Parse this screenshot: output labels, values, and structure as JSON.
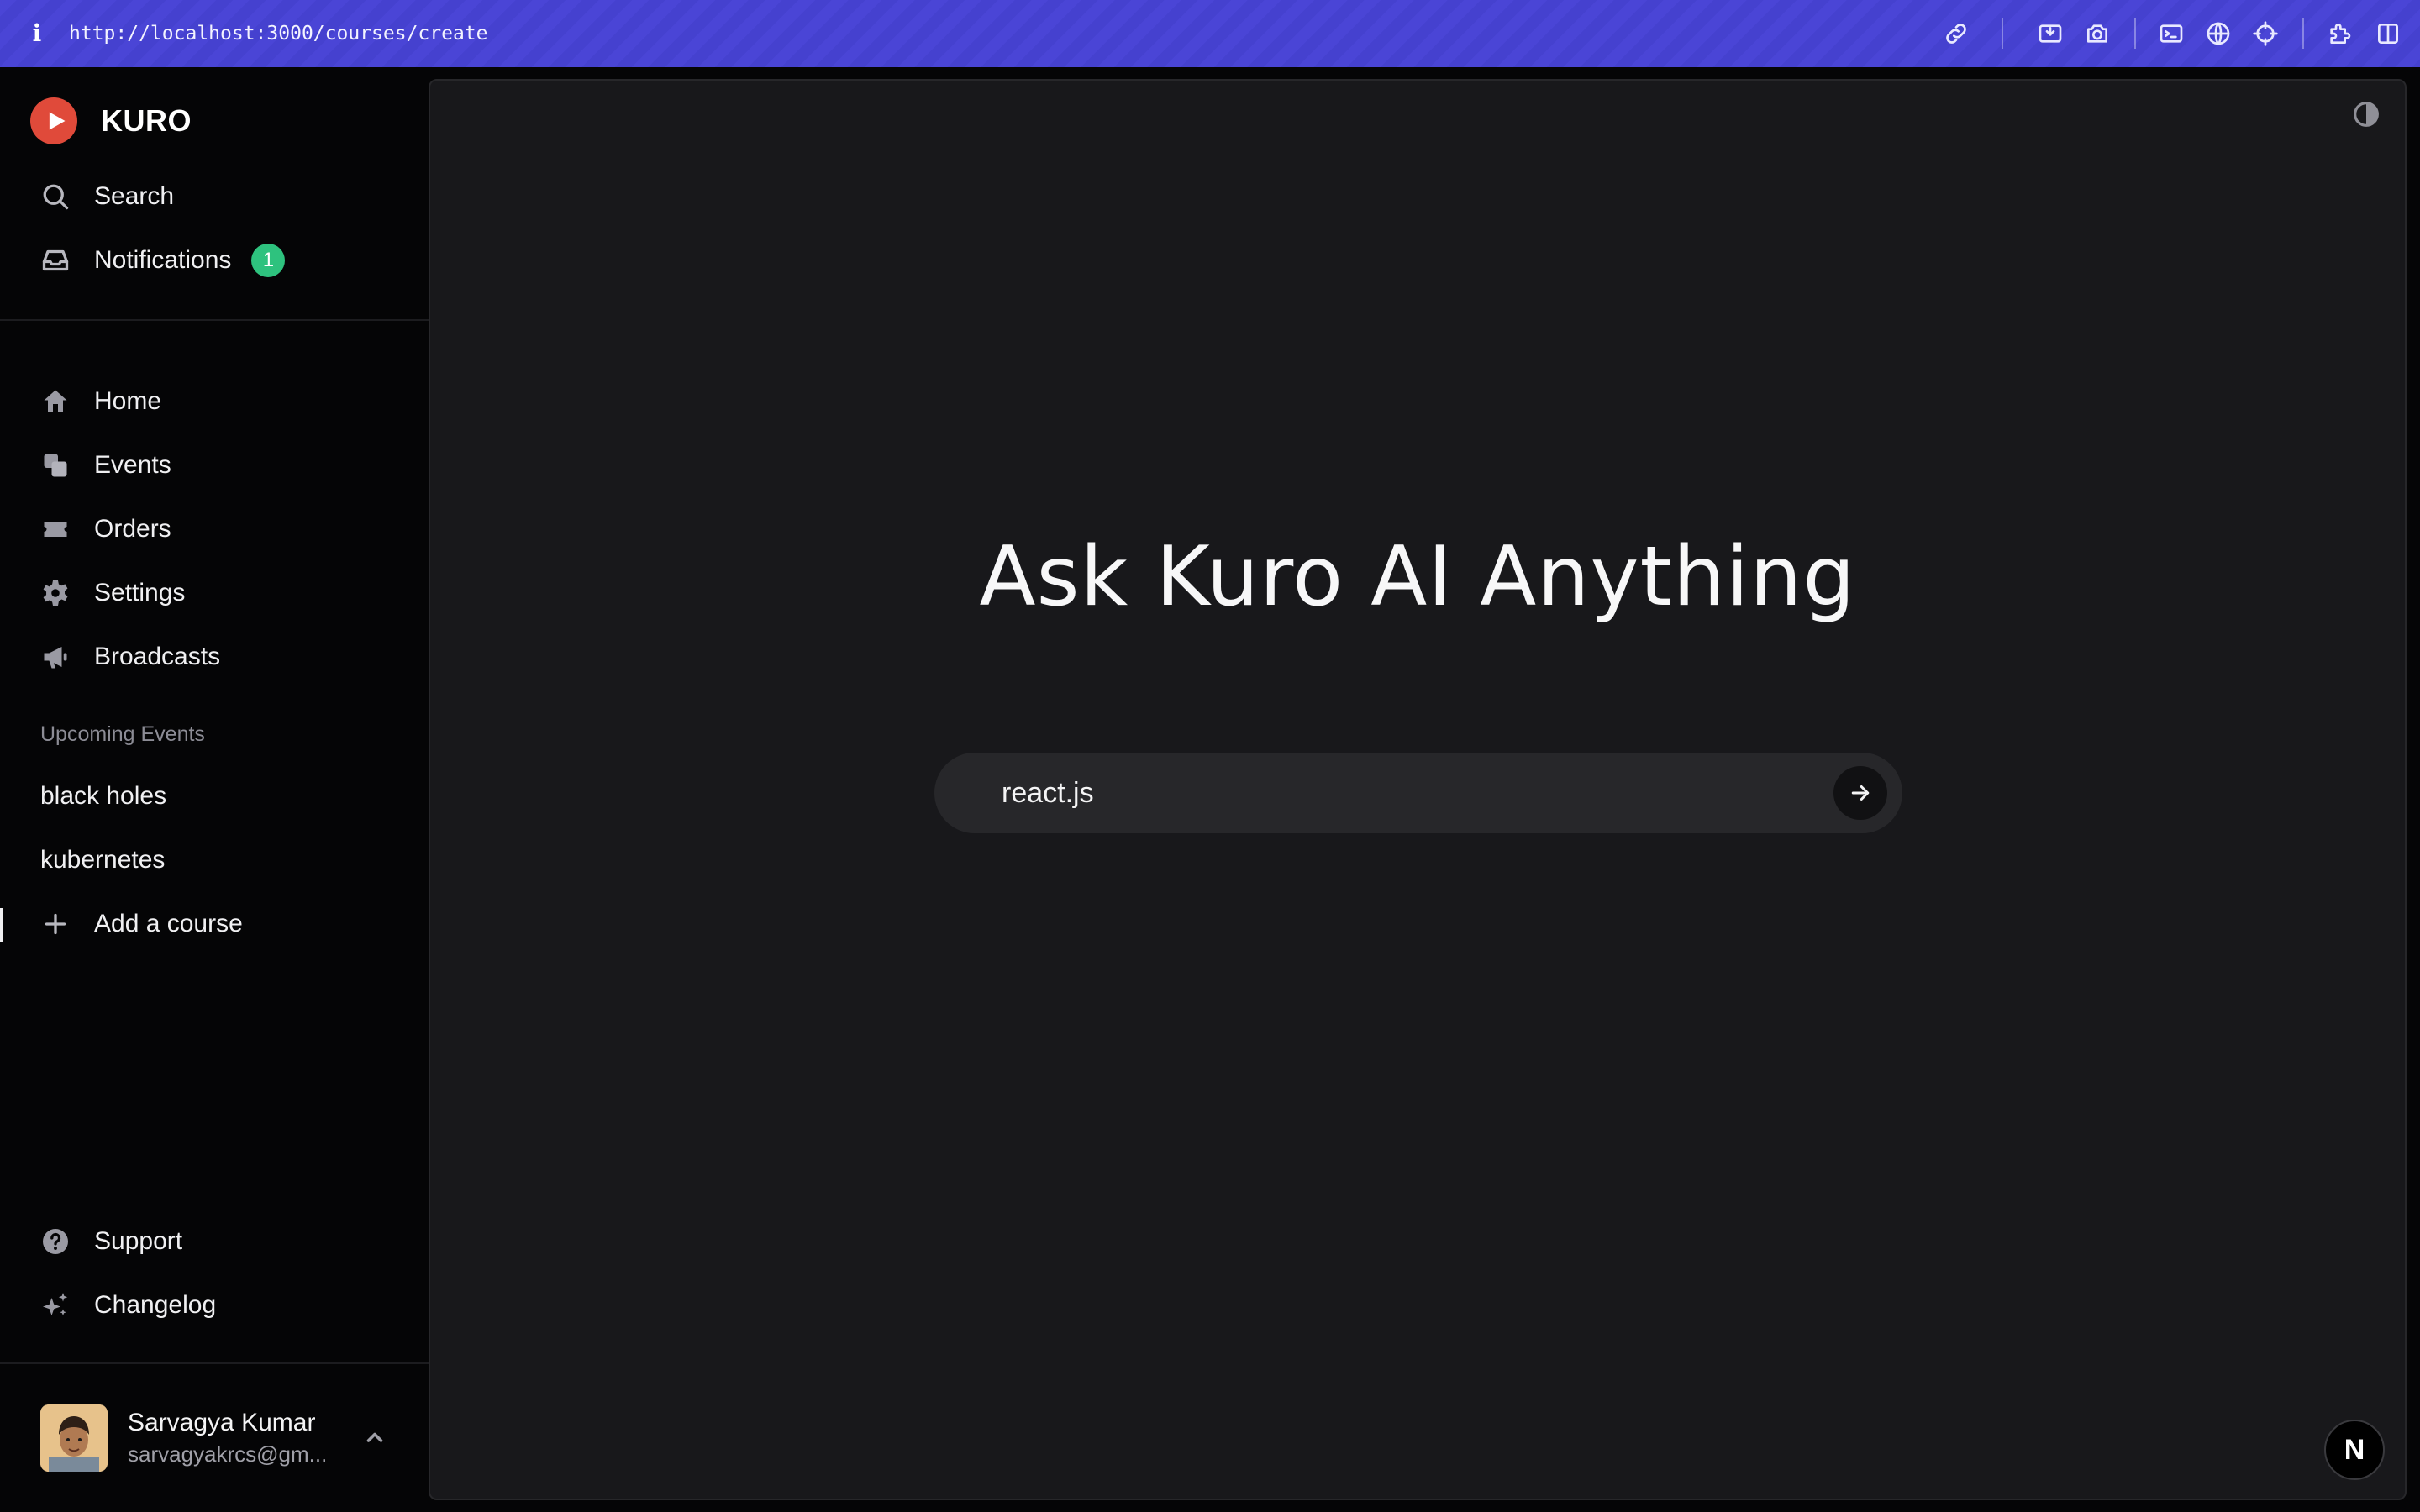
{
  "browser": {
    "url": "http://localhost:3000/courses/create",
    "info_icon": "i",
    "tools": [
      "link-icon",
      "screenshot-area-icon",
      "camera-icon",
      "terminal-icon",
      "globe-icon",
      "crosshair-icon",
      "extensions-icon",
      "sidebar-icon"
    ]
  },
  "brand": {
    "name": "KURO",
    "logo_color": "#e04a3a"
  },
  "top_nav": [
    {
      "label": "Search",
      "icon": "search-icon"
    },
    {
      "label": "Notifications",
      "icon": "inbox-icon",
      "badge": "1",
      "badge_color": "#2ec27e"
    }
  ],
  "nav": [
    {
      "label": "Home",
      "icon": "home-icon"
    },
    {
      "label": "Events",
      "icon": "events-icon"
    },
    {
      "label": "Orders",
      "icon": "ticket-icon"
    },
    {
      "label": "Settings",
      "icon": "gear-icon"
    },
    {
      "label": "Broadcasts",
      "icon": "megaphone-icon"
    }
  ],
  "upcoming": {
    "label": "Upcoming Events",
    "items": [
      "black holes",
      "kubernetes"
    ],
    "add_label": "Add a course"
  },
  "bottom_nav": [
    {
      "label": "Support",
      "icon": "help-icon"
    },
    {
      "label": "Changelog",
      "icon": "sparkles-icon"
    }
  ],
  "user": {
    "name": "Sarvagya Kumar",
    "email": "sarvagyakrcs@gm..."
  },
  "main": {
    "heading": "Ask Kuro AI Anything",
    "prompt_value": "react.js",
    "next_badge": "N"
  }
}
